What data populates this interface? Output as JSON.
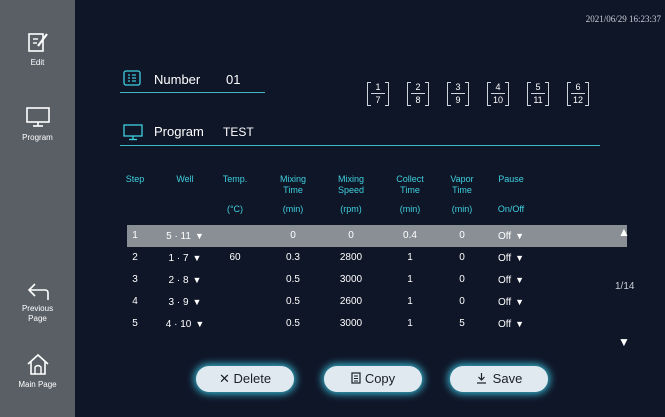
{
  "datetime": "2021/06/29 16:23:37",
  "sidebar": {
    "items": [
      {
        "label": "Edit",
        "icon": "edit-icon"
      },
      {
        "label": "Program",
        "icon": "monitor-icon"
      },
      {
        "label": "Previous Page",
        "icon": "back-arrow-icon"
      },
      {
        "label": "Main Page",
        "icon": "home-icon"
      }
    ]
  },
  "number": {
    "label": "Number",
    "value": "01"
  },
  "program": {
    "label": "Program",
    "value": "TEST"
  },
  "wells": [
    {
      "top": "1",
      "bottom": "7"
    },
    {
      "top": "2",
      "bottom": "8"
    },
    {
      "top": "3",
      "bottom": "9"
    },
    {
      "top": "4",
      "bottom": "10"
    },
    {
      "top": "5",
      "bottom": "11"
    },
    {
      "top": "6",
      "bottom": "12"
    }
  ],
  "table": {
    "headers": [
      {
        "l1": "Step",
        "l2": "",
        "l3": ""
      },
      {
        "l1": "Well",
        "l2": "",
        "l3": ""
      },
      {
        "l1": "Temp.",
        "l2": "",
        "l3": "(°C)"
      },
      {
        "l1": "Mixing",
        "l2": "Time",
        "l3": "(min)"
      },
      {
        "l1": "Mixing",
        "l2": "Speed",
        "l3": "(rpm)"
      },
      {
        "l1": "Collect",
        "l2": "Time",
        "l3": "(min)"
      },
      {
        "l1": "Vapor",
        "l2": "Time",
        "l3": "(min)"
      },
      {
        "l1": "Pause",
        "l2": "",
        "l3": "On/Off"
      }
    ],
    "rows": [
      {
        "step": "1",
        "well": "5 · 11",
        "temp": "",
        "mix_time": "0",
        "mix_speed": "0",
        "collect": "0.4",
        "vapor": "0",
        "pause": "Off"
      },
      {
        "step": "2",
        "well": "1 · 7",
        "temp": "60",
        "mix_time": "0.3",
        "mix_speed": "2800",
        "collect": "1",
        "vapor": "0",
        "pause": "Off"
      },
      {
        "step": "3",
        "well": "2 · 8",
        "temp": "",
        "mix_time": "0.5",
        "mix_speed": "3000",
        "collect": "1",
        "vapor": "0",
        "pause": "Off"
      },
      {
        "step": "4",
        "well": "3 · 9",
        "temp": "",
        "mix_time": "0.5",
        "mix_speed": "2600",
        "collect": "1",
        "vapor": "0",
        "pause": "Off"
      },
      {
        "step": "5",
        "well": "4 · 10",
        "temp": "",
        "mix_time": "0.5",
        "mix_speed": "3000",
        "collect": "1",
        "vapor": "5",
        "pause": "Off"
      }
    ],
    "selected_row": 0,
    "dropdown_arrow": "▼"
  },
  "pagination": {
    "indicator": "1/14",
    "up": "▲",
    "down": "▼"
  },
  "buttons": {
    "delete": "Delete",
    "copy": "Copy",
    "save": "Save"
  },
  "colors": {
    "accent": "#3fd0df",
    "sidebar": "#5a5f66",
    "background": "#0f1628",
    "selected_row": "#8a8f96"
  }
}
